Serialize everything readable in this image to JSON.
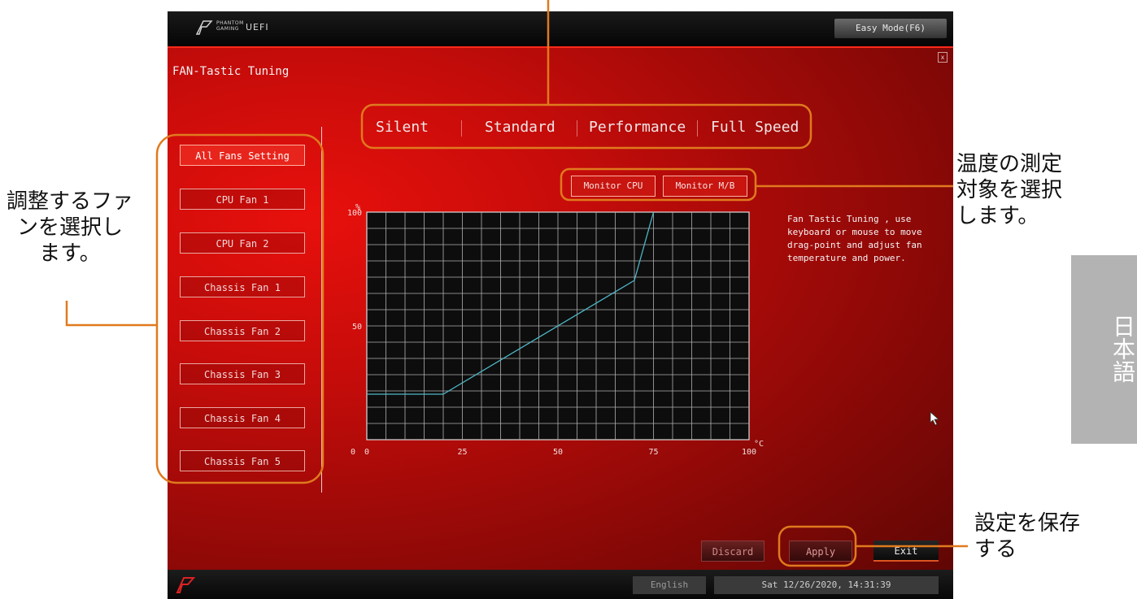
{
  "topbar": {
    "brand_small": "PHANTOM GAMING",
    "brand_uefi": "UEFI",
    "easy_mode_label": "Easy Mode(F6)",
    "close_label": "x"
  },
  "page_title": "FAN-Tastic Tuning",
  "modes": [
    "Silent",
    "Standard",
    "Performance",
    "Full Speed"
  ],
  "fans": [
    "All Fans Setting",
    "CPU Fan 1",
    "CPU Fan 2",
    "Chassis Fan 1",
    "Chassis Fan 2",
    "Chassis Fan 3",
    "Chassis Fan 4",
    "Chassis Fan 5"
  ],
  "active_fan": "All Fans Setting",
  "monitor": {
    "cpu_label": "Monitor CPU",
    "mb_label": "Monitor M/B"
  },
  "description": "Fan Tastic Tuning , use keyboard or mouse to move drag-point and adjust fan temperature and power.",
  "buttons": {
    "discard": "Discard",
    "apply": "Apply",
    "exit": "Exit"
  },
  "footer": {
    "language": "English",
    "datetime": "Sat 12/26/2020, 14:31:39"
  },
  "annotations": {
    "select_fan": "調整するファ\nンを選択し\nます。",
    "select_temp": "温度の測定\n対象を選択\nします。",
    "save": "設定を保存\nする",
    "language_tab": "日本語"
  },
  "colors": {
    "annotation": "#e07a1e",
    "curve": "#4fb8c8",
    "grid": "#b0b0b0"
  },
  "chart_data": {
    "type": "line",
    "xlabel": "°C",
    "ylabel": "%",
    "xlim": [
      0,
      100
    ],
    "ylim": [
      0,
      100
    ],
    "x_ticks": [
      "0",
      "25",
      "50",
      "75",
      "100"
    ],
    "y_ticks": [
      "0",
      "50",
      "100"
    ],
    "grid": true,
    "series": [
      {
        "x": [
          0,
          20,
          70,
          75
        ],
        "y": [
          20,
          20,
          70,
          100
        ]
      }
    ]
  }
}
